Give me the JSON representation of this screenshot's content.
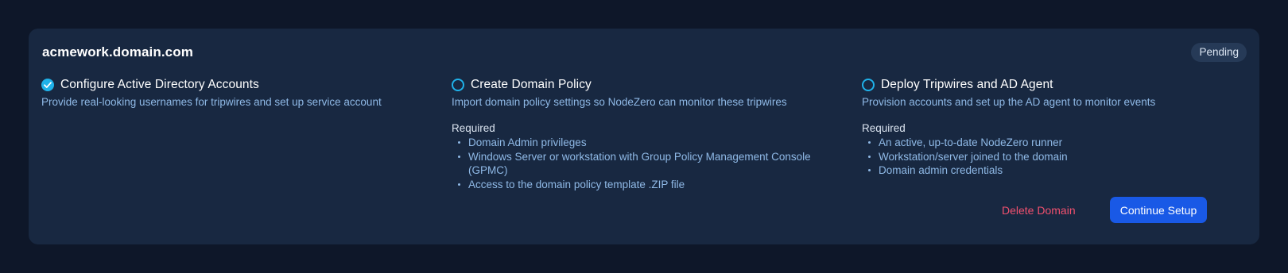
{
  "domain": {
    "name": "acmework.domain.com",
    "status": "Pending"
  },
  "steps": [
    {
      "state": "complete",
      "icon": "check-circle-icon",
      "title": "Configure Active Directory Accounts",
      "description": "Provide real-looking usernames for tripwires and set up service account"
    },
    {
      "state": "incomplete",
      "icon": "empty-circle-icon",
      "title": "Create Domain Policy",
      "description": "Import domain policy settings so NodeZero can monitor these tripwires",
      "required_label": "Required",
      "requirements": [
        "Domain Admin privileges",
        "Windows Server or workstation with Group Policy Management Console (GPMC)",
        "Access to the domain policy template .ZIP file"
      ]
    },
    {
      "state": "incomplete",
      "icon": "empty-circle-icon",
      "title": "Deploy Tripwires and AD Agent",
      "description": "Provision accounts and set up the AD agent to monitor events",
      "required_label": "Required",
      "requirements": [
        "An active, up-to-date NodeZero runner",
        "Workstation/server joined to the domain",
        "Domain admin credentials"
      ]
    }
  ],
  "actions": {
    "delete_label": "Delete Domain",
    "continue_label": "Continue Setup"
  },
  "colors": {
    "page_background": "#0e1729",
    "card_background": "#182841",
    "accent": "#1fb2ea",
    "primary_button": "#1959e6",
    "danger_text": "#f0506e",
    "muted_text": "#8fb9e6"
  }
}
